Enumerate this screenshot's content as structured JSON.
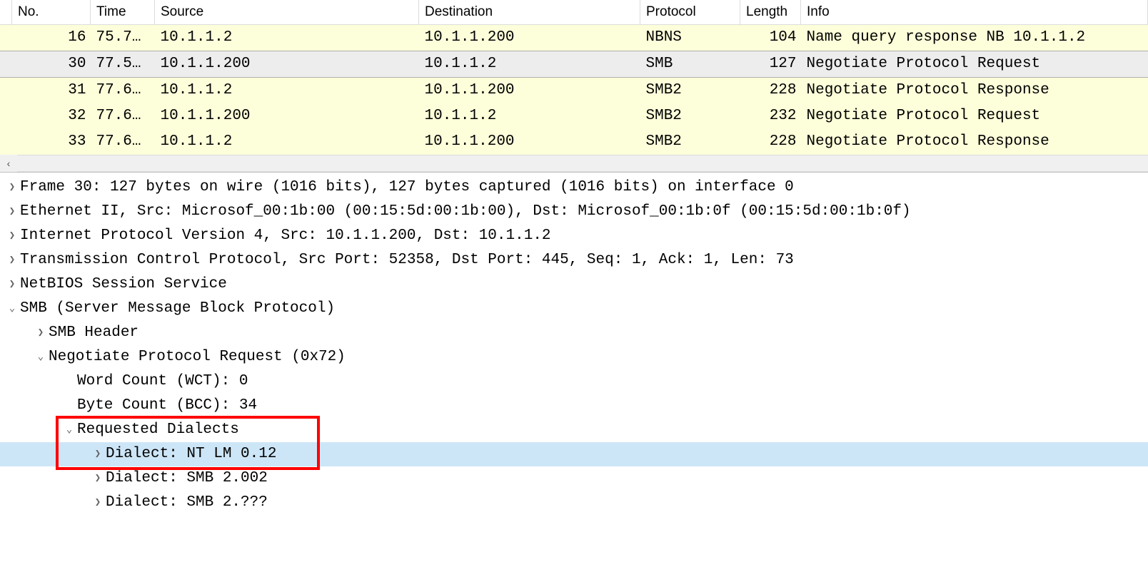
{
  "columns": {
    "no": "No.",
    "time": "Time",
    "source": "Source",
    "destination": "Destination",
    "protocol": "Protocol",
    "length": "Length",
    "info": "Info"
  },
  "packets": [
    {
      "no": "16",
      "time": "75.7…",
      "src": "10.1.1.2",
      "dst": "10.1.1.200",
      "proto": "NBNS",
      "len": "104",
      "info": "Name query response NB 10.1.1.2",
      "selected": false
    },
    {
      "no": "30",
      "time": "77.5…",
      "src": "10.1.1.200",
      "dst": "10.1.1.2",
      "proto": "SMB",
      "len": "127",
      "info": "Negotiate Protocol Request",
      "selected": true
    },
    {
      "no": "31",
      "time": "77.6…",
      "src": "10.1.1.2",
      "dst": "10.1.1.200",
      "proto": "SMB2",
      "len": "228",
      "info": "Negotiate Protocol Response",
      "selected": false
    },
    {
      "no": "32",
      "time": "77.6…",
      "src": "10.1.1.200",
      "dst": "10.1.1.2",
      "proto": "SMB2",
      "len": "232",
      "info": "Negotiate Protocol Request",
      "selected": false
    },
    {
      "no": "33",
      "time": "77.6…",
      "src": "10.1.1.2",
      "dst": "10.1.1.200",
      "proto": "SMB2",
      "len": "228",
      "info": "Negotiate Protocol Response",
      "selected": false
    }
  ],
  "scroll_left_glyph": "‹",
  "details": {
    "frame": "Frame 30: 127 bytes on wire (1016 bits), 127 bytes captured (1016 bits) on interface 0",
    "eth": "Ethernet II, Src: Microsof_00:1b:00 (00:15:5d:00:1b:00), Dst: Microsof_00:1b:0f (00:15:5d:00:1b:0f)",
    "ip": "Internet Protocol Version 4, Src: 10.1.1.200, Dst: 10.1.1.2",
    "tcp": "Transmission Control Protocol, Src Port: 52358, Dst Port: 445, Seq: 1, Ack: 1, Len: 73",
    "nbss": "NetBIOS Session Service",
    "smb": "SMB (Server Message Block Protocol)",
    "smbhdr": "SMB Header",
    "negreq": "Negotiate Protocol Request (0x72)",
    "wct": "Word Count (WCT): 0",
    "bcc": "Byte Count (BCC): 34",
    "reqdial": "Requested Dialects",
    "d1": "Dialect: NT LM 0.12",
    "d2": "Dialect: SMB 2.002",
    "d3": "Dialect: SMB 2.???"
  }
}
